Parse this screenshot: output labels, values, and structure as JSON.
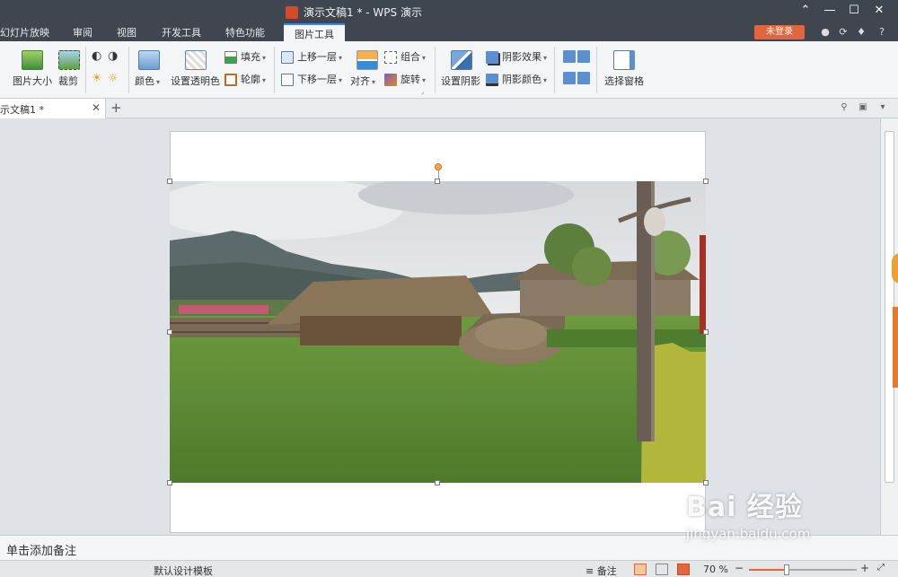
{
  "window": {
    "title": "演示文稿1 * - WPS 演示",
    "controls": [
      "chevron-up-icon",
      "minimize-icon",
      "maximize-icon",
      "close-icon"
    ]
  },
  "menu": {
    "tabs": [
      "幻灯片放映",
      "审阅",
      "视图",
      "开发工具",
      "特色功能",
      "图片工具"
    ],
    "active_tab": "图片工具",
    "login": "未登录",
    "help": "?"
  },
  "ribbon": {
    "picture_size": "图片大小",
    "crop": "裁剪",
    "color": "颜色",
    "set_transparent": "设置透明色",
    "fill": "填充",
    "outline": "轮廓",
    "bring_forward": "上移一层",
    "send_backward": "下移一层",
    "align": "对齐",
    "group": "组合",
    "rotate": "旋转",
    "set_shadow": "设置阴影",
    "shadow_effect": "阴影效果",
    "shadow_color": "阴影颜色",
    "selection_pane": "选择窗格"
  },
  "doc_tab": {
    "label": "示文稿1 *",
    "close": "✕",
    "new": "+"
  },
  "notes": {
    "placeholder": "单击添加备注"
  },
  "status": {
    "template": "默认设计模板",
    "notes": "备注",
    "zoom": "70 %",
    "zoom_level": 0.35
  },
  "watermark": {
    "brand": "Bai 经验",
    "url": "jingyan.baidu.com"
  },
  "colors": {
    "titlebar": "#3f4650",
    "accent": "#3b8bd6",
    "login": "#e2663d"
  }
}
